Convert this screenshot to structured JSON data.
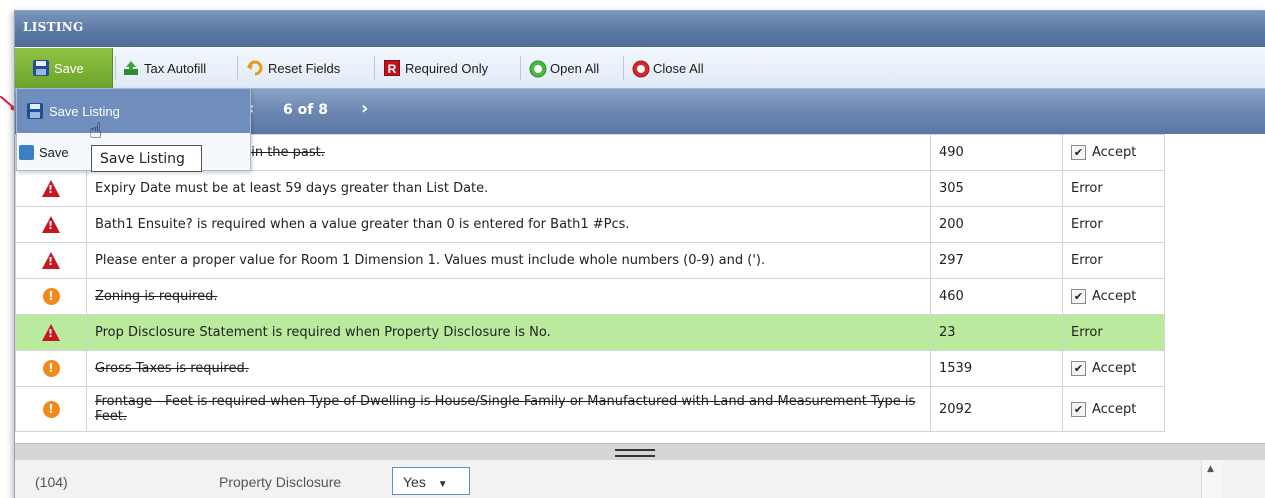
{
  "panel": {
    "title": "LISTING"
  },
  "toolbar": {
    "save_label": "Save",
    "tax_autofill_label": "Tax Autofill",
    "reset_fields_label": "Reset Fields",
    "required_only_label": "Required Only",
    "required_only_badge": "R",
    "open_all_label": "Open All",
    "close_all_label": "Close All"
  },
  "pager": {
    "text": "6 of 8"
  },
  "dropdown": {
    "item1": "Save Listing",
    "item2": "Save"
  },
  "tooltip": {
    "text": "Save Listing"
  },
  "rows": [
    {
      "icon": "info",
      "message": "… be more than 7 days in the past.",
      "code": "490",
      "status": "Accept",
      "struck": true,
      "checked": true
    },
    {
      "icon": "warning",
      "message": "Expiry Date must be at least 59 days greater than List Date.",
      "code": "305",
      "status": "Error",
      "struck": false,
      "checked": false
    },
    {
      "icon": "warning",
      "message": "Bath1 Ensuite? is required when a value greater than 0 is entered for Bath1 #Pcs.",
      "code": "200",
      "status": "Error",
      "struck": false,
      "checked": false
    },
    {
      "icon": "warning",
      "message": "Please enter a proper value for Room 1 Dimension 1. Values must include whole numbers (0-9) and (').",
      "code": "297",
      "status": "Error",
      "struck": false,
      "checked": false
    },
    {
      "icon": "info",
      "message": "Zoning is required.",
      "code": "460",
      "status": "Accept",
      "struck": true,
      "checked": true
    },
    {
      "icon": "warning",
      "message": "Prop Disclosure Statement is required when Property Disclosure is No.",
      "code": "23",
      "status": "Error",
      "struck": false,
      "checked": false,
      "highlight": true
    },
    {
      "icon": "info",
      "message": "Gross Taxes is required.",
      "code": "1539",
      "status": "Accept",
      "struck": true,
      "checked": true
    },
    {
      "icon": "info",
      "message": "Frontage - Feet is required when Type of Dwelling is House/Single Family or Manufactured with Land and Measurement Type is Feet.",
      "code": "2092",
      "status": "Accept",
      "struck": true,
      "checked": true
    }
  ],
  "bottom": {
    "code": "(104)",
    "label": "Property Disclosure",
    "select_value": "Yes",
    "select_caret": "▼"
  },
  "colors": {
    "highlight_row": "#b9ea9e",
    "error_icon": "#c9151e",
    "info_icon": "#f08a1b",
    "save_green": "#6ba42a"
  }
}
